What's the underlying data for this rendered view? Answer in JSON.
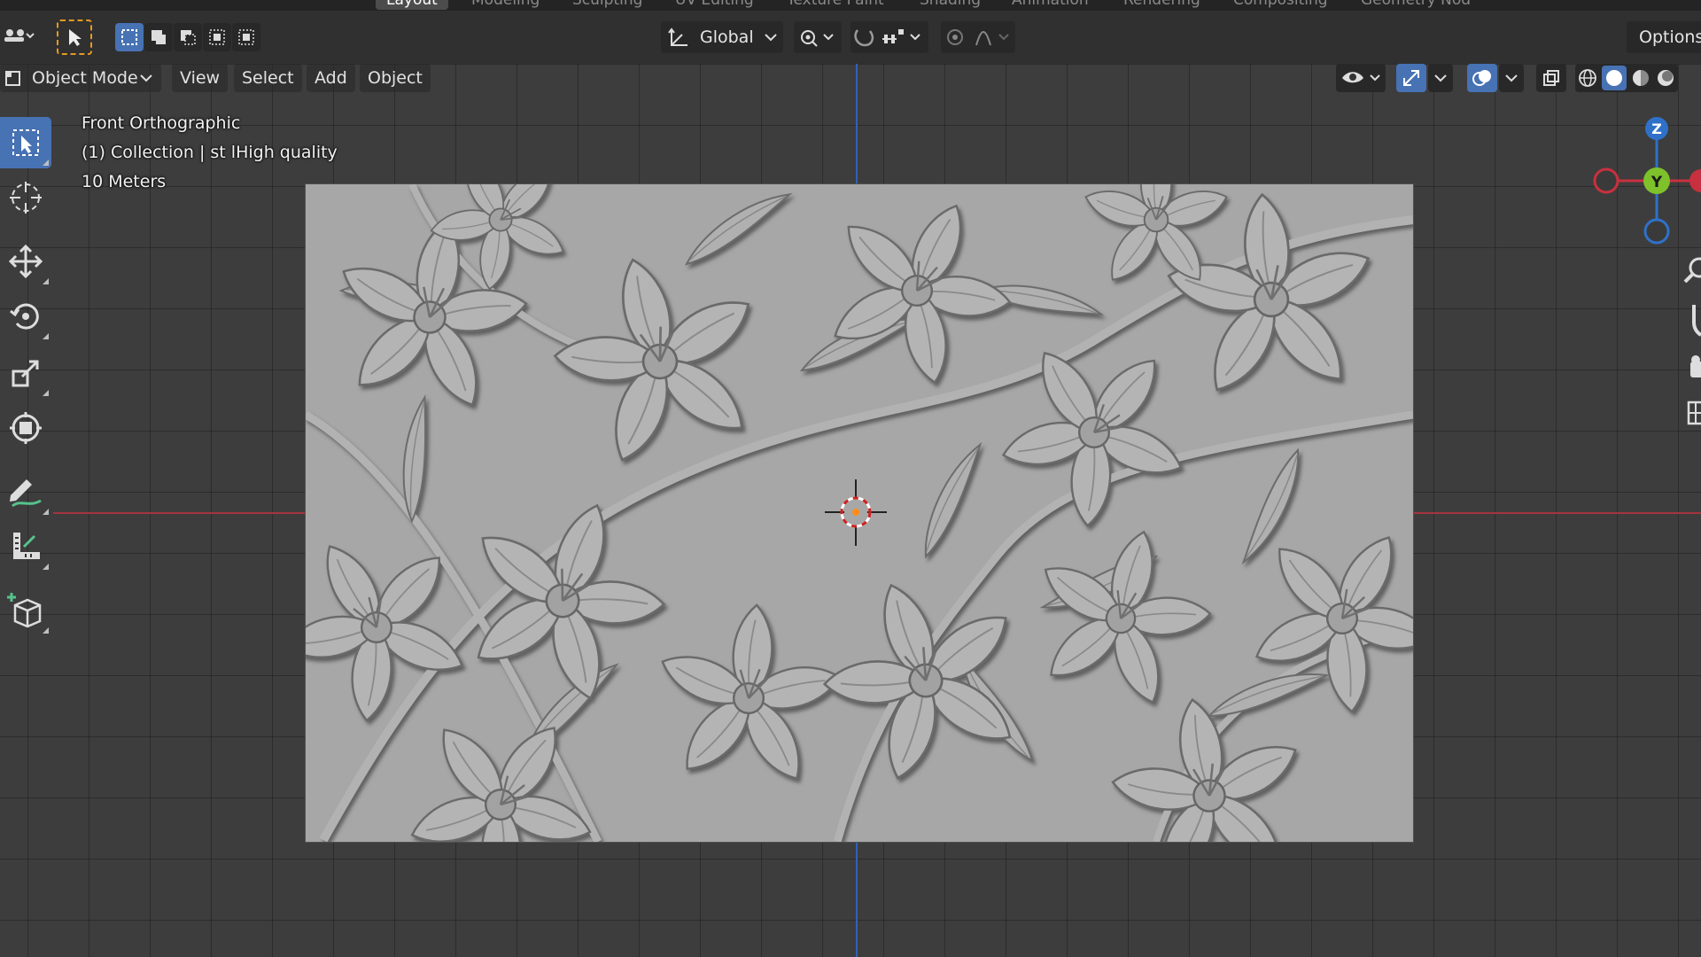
{
  "workspace_tabs": [
    {
      "label": "Layout",
      "active": true
    },
    {
      "label": "Modeling",
      "active": false
    },
    {
      "label": "Sculpting",
      "active": false
    },
    {
      "label": "UV Editing",
      "active": false
    },
    {
      "label": "Texture Paint",
      "active": false
    },
    {
      "label": "Shading",
      "active": false
    },
    {
      "label": "Animation",
      "active": false
    },
    {
      "label": "Rendering",
      "active": false
    },
    {
      "label": "Compositing",
      "active": false
    },
    {
      "label": "Geometry Nod",
      "active": false
    }
  ],
  "tool_header": {
    "transform_orientation": "Global",
    "options_label": "Options"
  },
  "view_header": {
    "mode": "Object Mode",
    "menus": [
      "View",
      "Select",
      "Add",
      "Object"
    ]
  },
  "overlay": {
    "view_name": "Front Orthographic",
    "collection": "(1) Collection | st lHigh quality",
    "scale": "10 Meters"
  },
  "gizmo": {
    "z_label": "Z",
    "y_label": "Y",
    "x_color": "#c8303f",
    "y_color": "#7ec12b",
    "z_color": "#2f71c9"
  },
  "colors": {
    "accent": "#4772b3",
    "x_axis": "#a4343f",
    "z_axis": "#2f62b8",
    "relief": "#a7a7a7"
  }
}
